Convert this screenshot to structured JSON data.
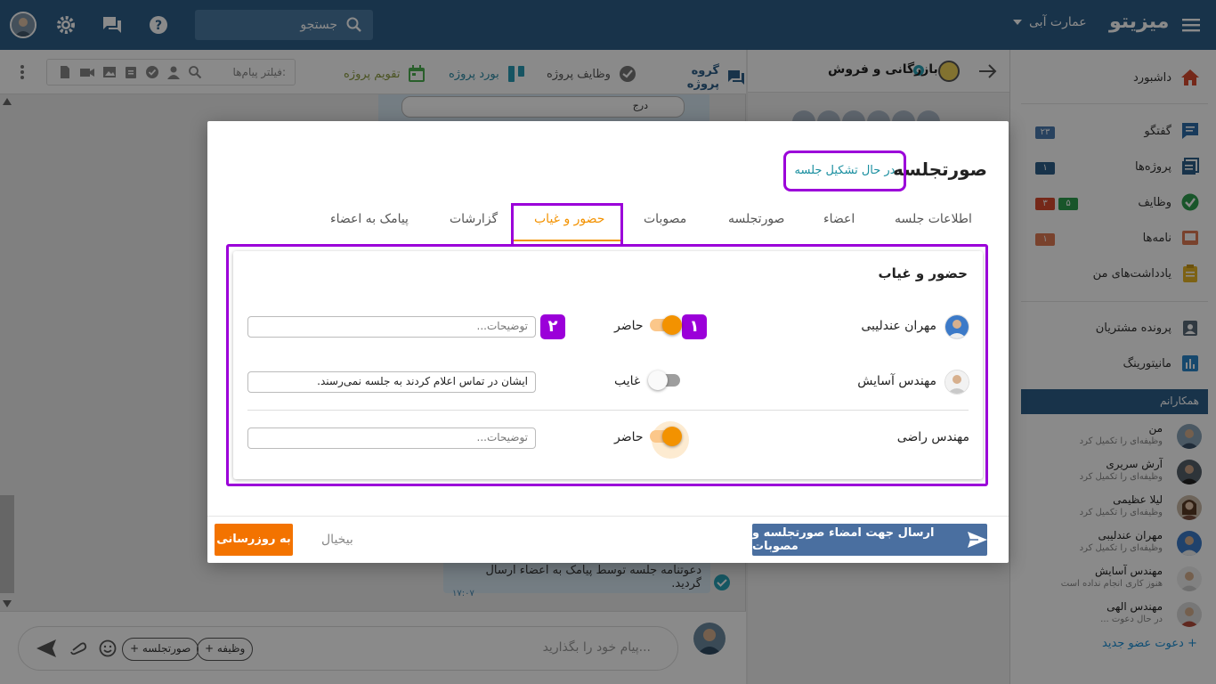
{
  "topbar": {
    "brand": "میزیتو",
    "org": "عمارت آبی",
    "search_placeholder": "جستجو"
  },
  "sidebar": {
    "items": [
      {
        "label": "داشبورد",
        "icon": "home-icon"
      },
      {
        "label": "گفتگو",
        "icon": "chat-icon",
        "badge": "۲۳"
      },
      {
        "label": "پروژه‌ها",
        "icon": "projects-icon",
        "badge": "۱"
      },
      {
        "label": "وظایف",
        "icon": "tasks-icon",
        "badge_red": "۳",
        "badge_green": "۵"
      },
      {
        "label": "نامه‌ها",
        "icon": "letters-icon",
        "badge": "۱"
      },
      {
        "label": "یادداشت‌های من",
        "icon": "notes-icon"
      },
      {
        "label": "پرونده مشتریان",
        "icon": "customers-icon"
      },
      {
        "label": "مانیتورینگ",
        "icon": "monitoring-icon"
      }
    ],
    "colleagues_header": "همکارانم",
    "colleagues": [
      {
        "name": "من",
        "status": "وظیفه‌ای را تکمیل کرد"
      },
      {
        "name": "آرش سریری",
        "status": "وظیفه‌ای را تکمیل کرد"
      },
      {
        "name": "لیلا عظیمی",
        "status": "وظیفه‌ای را تکمیل کرد"
      },
      {
        "name": "مهران عندلیبی",
        "status": "وظیفه‌ای را تکمیل کرد"
      },
      {
        "name": "مهندس آسایش",
        "status": "هنوز کاری انجام نداده است"
      },
      {
        "name": "مهندس الهی",
        "status": "در حال دعوت ..."
      }
    ],
    "invite": "دعوت عضو جدید"
  },
  "middle": {
    "title": "بازرگانی و فروش"
  },
  "chat": {
    "tabs": [
      {
        "label": "گروه پروژه",
        "icon": "group-chat-icon"
      },
      {
        "label": "وظایف پروژه",
        "icon": "project-tasks-icon"
      },
      {
        "label": "بورد پروژه",
        "icon": "board-icon"
      },
      {
        "label": "تقویم پروژه",
        "icon": "calendar-icon"
      }
    ],
    "filter_placeholder": "فیلتر پیام‌ها:",
    "bubble_text": "دعوتنامه جلسه توسط پیامک به اعضاء ارسال گردید.",
    "bubble_time": "۱۷:۰۷",
    "partial_field": "درج",
    "composer_placeholder": "پیام خود را بگذارید...",
    "chip_task": "+ وظیفه",
    "chip_minutes": "+ صورتجلسه"
  },
  "modal": {
    "title": "صورتجلسه",
    "status": "در حال تشکیل جلسه",
    "tabs": [
      "اطلاعات جلسه",
      "اعضاء",
      "صورتجلسه",
      "مصوبات",
      "حضور و غیاب",
      "گزارشات",
      "پیامک به اعضاء"
    ],
    "active_tab": "حضور و غیاب",
    "card_title": "حضور و غیاب",
    "rows": [
      {
        "name": "مهران عندلیبی",
        "present": true,
        "state": "حاضر",
        "note": "",
        "placeholder": "توضیحات..."
      },
      {
        "name": "مهندس آسایش",
        "present": false,
        "state": "غایب",
        "note": "ایشان در تماس اعلام کردند به جلسه نمی‌رسند.",
        "placeholder": "توضیحات..."
      },
      {
        "name": "مهندس راضی",
        "present": true,
        "state": "حاضر",
        "note": "",
        "placeholder": "توضیحات..."
      }
    ],
    "marker_1": "۱",
    "marker_2": "۲",
    "send_button": "ارسال جهت امضاء صورتجلسه و مصوبات",
    "cancel_button": "بیخیال",
    "update_button": "به روزرسانی"
  },
  "colors": {
    "primary": "#2d5f8a",
    "accent": "#f39200",
    "highlight": "#9b00d9",
    "status_text": "#1a8fa0",
    "update_button": "#f37300",
    "send_button": "#4a6fa0"
  }
}
